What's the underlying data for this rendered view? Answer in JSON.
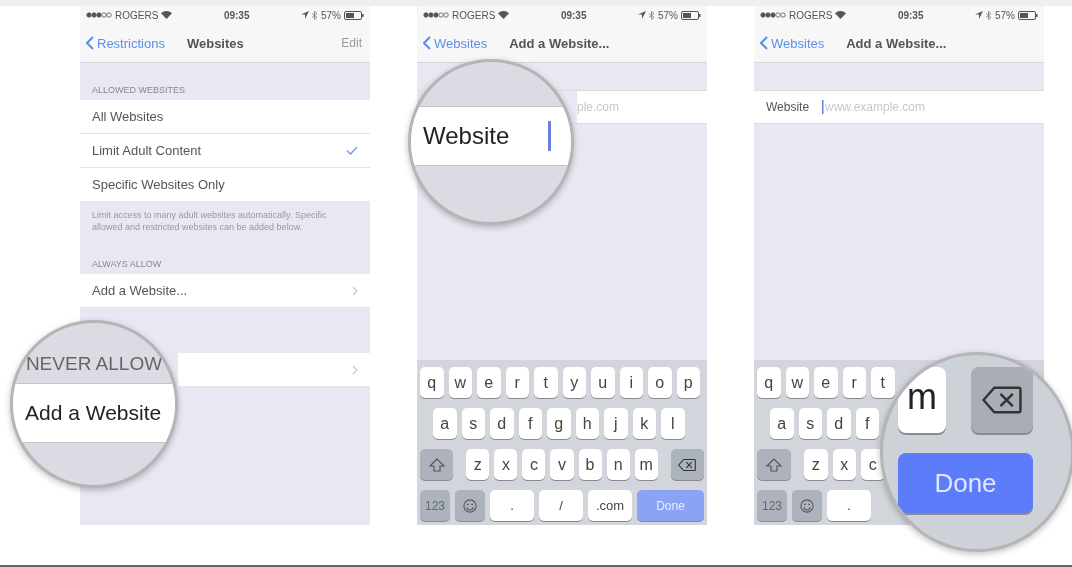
{
  "panels": [
    {
      "kind": "list",
      "status": {
        "carrier": "ROGERS",
        "time": "09:35",
        "battery": "57%"
      },
      "nav": {
        "back": "Restrictions",
        "title": "Websites",
        "action": "Edit"
      },
      "sections": [
        {
          "header": "ALLOWED WEBSITES",
          "rows": [
            {
              "kind": "choice",
              "label": "All Websites",
              "selected": false
            },
            {
              "kind": "choice",
              "label": "Limit Adult Content",
              "selected": true
            },
            {
              "kind": "choice",
              "label": "Specific Websites Only",
              "selected": false
            }
          ],
          "footer": "Limit access to many adult websites automatically. Specific allowed and restricted websites can be added below."
        },
        {
          "header": "ALWAYS ALLOW",
          "rows": [
            {
              "kind": "link",
              "label": "Add a Website..."
            }
          ]
        },
        {
          "rows": [
            {
              "kind": "link"
            }
          ]
        }
      ],
      "lens": {
        "kind": "section",
        "header": "NEVER ALLOW",
        "row": "Add a Website"
      }
    },
    {
      "kind": "form",
      "status": {
        "carrier": "ROGERS",
        "time": "09:35",
        "battery": "57%"
      },
      "nav": {
        "back": "Websites",
        "title": "Add a Website..."
      },
      "field": {
        "placeholder": "ple.com"
      },
      "keyboard": [
        [
          {
            "kind": "letter",
            "label": "q"
          },
          {
            "kind": "letter",
            "label": "w"
          },
          {
            "kind": "letter",
            "label": "e"
          },
          {
            "kind": "letter",
            "label": "r"
          },
          {
            "kind": "letter",
            "label": "t"
          },
          {
            "kind": "letter",
            "label": "y"
          },
          {
            "kind": "letter",
            "label": "u"
          },
          {
            "kind": "letter",
            "label": "i"
          },
          {
            "kind": "letter",
            "label": "o"
          },
          {
            "kind": "letter",
            "label": "p"
          }
        ],
        [
          {
            "kind": "letter",
            "label": "a"
          },
          {
            "kind": "letter",
            "label": "s"
          },
          {
            "kind": "letter",
            "label": "d"
          },
          {
            "kind": "letter",
            "label": "f"
          },
          {
            "kind": "letter",
            "label": "g"
          },
          {
            "kind": "letter",
            "label": "h"
          },
          {
            "kind": "letter",
            "label": "j"
          },
          {
            "kind": "letter",
            "label": "k"
          },
          {
            "kind": "letter",
            "label": "l"
          }
        ],
        [
          {
            "kind": "shift"
          },
          {
            "kind": "letter",
            "label": "z"
          },
          {
            "kind": "letter",
            "label": "x"
          },
          {
            "kind": "letter",
            "label": "c"
          },
          {
            "kind": "letter",
            "label": "v"
          },
          {
            "kind": "letter",
            "label": "b"
          },
          {
            "kind": "letter",
            "label": "n"
          },
          {
            "kind": "letter",
            "label": "m"
          },
          {
            "kind": "delete"
          }
        ],
        [
          {
            "kind": "numbers",
            "label": "123"
          },
          {
            "kind": "emoji"
          },
          {
            "kind": "symbol",
            "label": "."
          },
          {
            "kind": "symbol",
            "label": "/"
          },
          {
            "kind": "symbol",
            "label": ".com"
          },
          {
            "kind": "done",
            "label": "Done"
          }
        ]
      ],
      "lens": {
        "kind": "field",
        "label": "Website",
        "focused": true
      }
    },
    {
      "kind": "form",
      "status": {
        "carrier": "ROGERS",
        "time": "09:35",
        "battery": "57%"
      },
      "nav": {
        "back": "Websites",
        "title": "Add a Website..."
      },
      "field": {
        "label": "Website",
        "placeholder": "www.example.com",
        "focused": true
      },
      "keyboard": [
        [
          {
            "kind": "letter",
            "label": "q"
          },
          {
            "kind": "letter",
            "label": "w"
          },
          {
            "kind": "letter",
            "label": "e"
          },
          {
            "kind": "letter",
            "label": "r"
          },
          {
            "kind": "letter",
            "label": "t"
          }
        ],
        [
          {
            "kind": "letter",
            "label": "a"
          },
          {
            "kind": "letter",
            "label": "s"
          },
          {
            "kind": "letter",
            "label": "d"
          },
          {
            "kind": "letter",
            "label": "f"
          }
        ],
        [
          {
            "kind": "shift"
          },
          {
            "kind": "letter",
            "label": "z"
          },
          {
            "kind": "letter",
            "label": "x"
          },
          {
            "kind": "letter",
            "label": "c"
          }
        ],
        [
          {
            "kind": "numbers",
            "label": "123"
          },
          {
            "kind": "emoji"
          },
          {
            "kind": "symbol",
            "label": "."
          }
        ]
      ],
      "lens": {
        "kind": "keys",
        "keys": [
          {
            "kind": "letter",
            "label": "m"
          },
          {
            "kind": "delete"
          },
          {
            "kind": "done",
            "label": "Done"
          }
        ]
      }
    }
  ]
}
